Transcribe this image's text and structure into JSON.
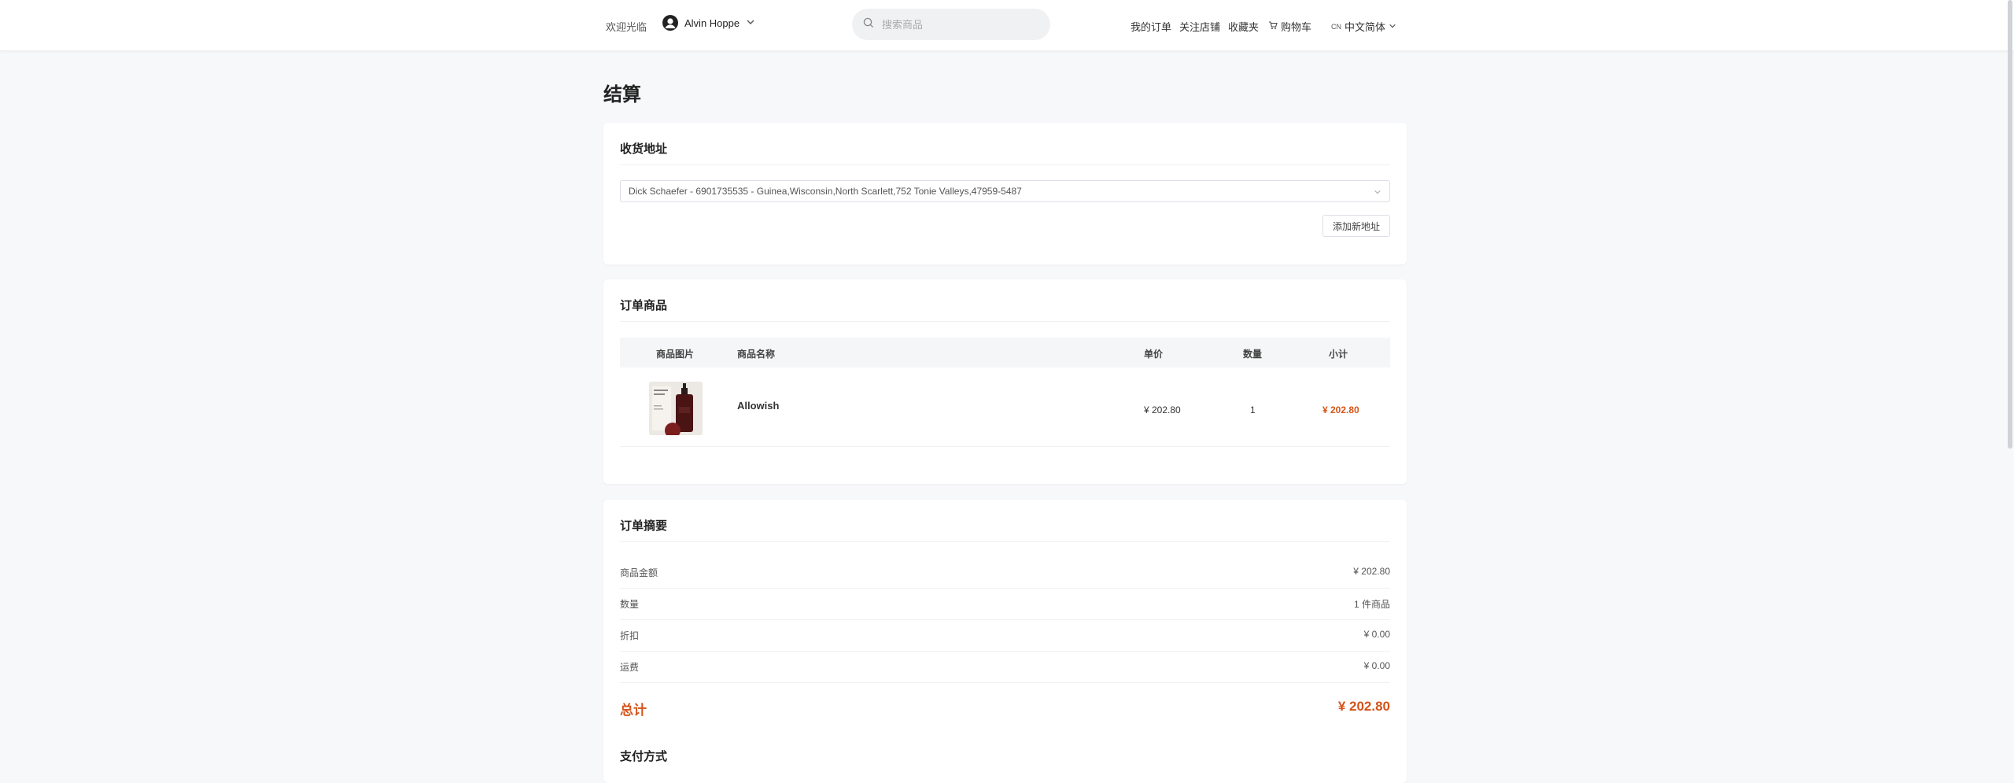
{
  "header": {
    "welcome": "欢迎光临",
    "user_name": "Alvin Hoppe",
    "search_placeholder": "搜索商品",
    "nav": [
      "我的订单",
      "关注店铺",
      "收藏夹",
      "购物车"
    ],
    "lang_code": "CN",
    "lang_label": "中文简体"
  },
  "page": {
    "title": "结算"
  },
  "address": {
    "section_title": "收货地址",
    "selected": "Dick Schaefer - 6901735535 - Guinea,Wisconsin,North Scarlett,752 Tonie Valleys,47959-5487",
    "add_button": "添加新地址"
  },
  "items": {
    "section_title": "订单商品",
    "columns": [
      "商品图片",
      "商品名称",
      "单价",
      "数量",
      "小计"
    ],
    "rows": [
      {
        "name": "Allowish",
        "unit_price": "¥ 202.80",
        "qty": "1",
        "subtotal": "¥ 202.80"
      }
    ]
  },
  "summary": {
    "section_title": "订单摘要",
    "rows": [
      {
        "label": "商品金额",
        "value": "¥ 202.80"
      },
      {
        "label": "数量",
        "value": "1 件商品"
      },
      {
        "label": "折扣",
        "value": "¥ 0.00"
      },
      {
        "label": "运费",
        "value": "¥ 0.00"
      }
    ],
    "total_label": "总计",
    "total_value": "¥ 202.80"
  },
  "payment": {
    "section_title": "支付方式"
  },
  "colors": {
    "accent": "#d4541a",
    "background": "#f7f8fa",
    "card": "#ffffff"
  }
}
